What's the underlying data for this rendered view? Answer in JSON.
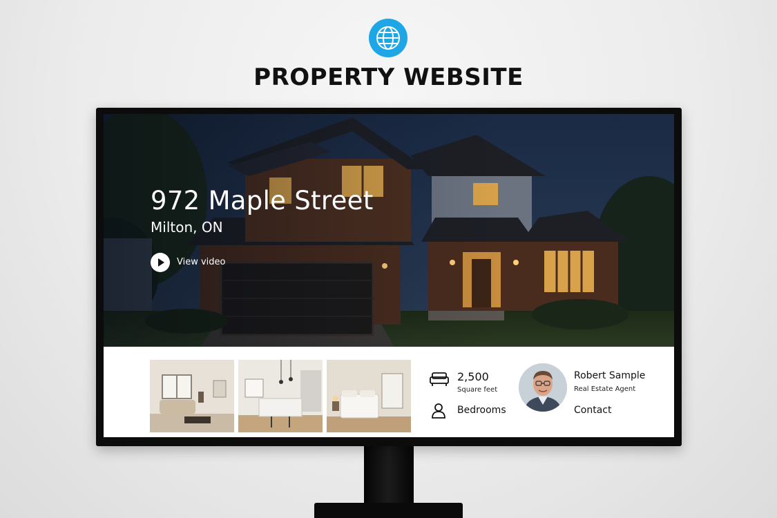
{
  "header": {
    "icon": "globe-icon",
    "icon_color": "#1fa6e6",
    "title": "PROPERTY WEBSITE"
  },
  "website": {
    "hero": {
      "address": "972 Maple Street",
      "city": "Milton, ON",
      "video_icon": "play-icon",
      "video_label": "View video"
    },
    "gallery": [
      {
        "name": "living-room-photo"
      },
      {
        "name": "kitchen-photo"
      },
      {
        "name": "bedroom-photo"
      }
    ],
    "stats": {
      "area_icon": "sofa-icon",
      "area_value": "2,500",
      "area_label": "Square feet",
      "bedrooms_icon": "person-icon",
      "bedrooms_label": "Bedrooms"
    },
    "agent": {
      "name": "Robert Sample",
      "role": "Real Estate Agent",
      "contact_label": "Contact"
    }
  }
}
